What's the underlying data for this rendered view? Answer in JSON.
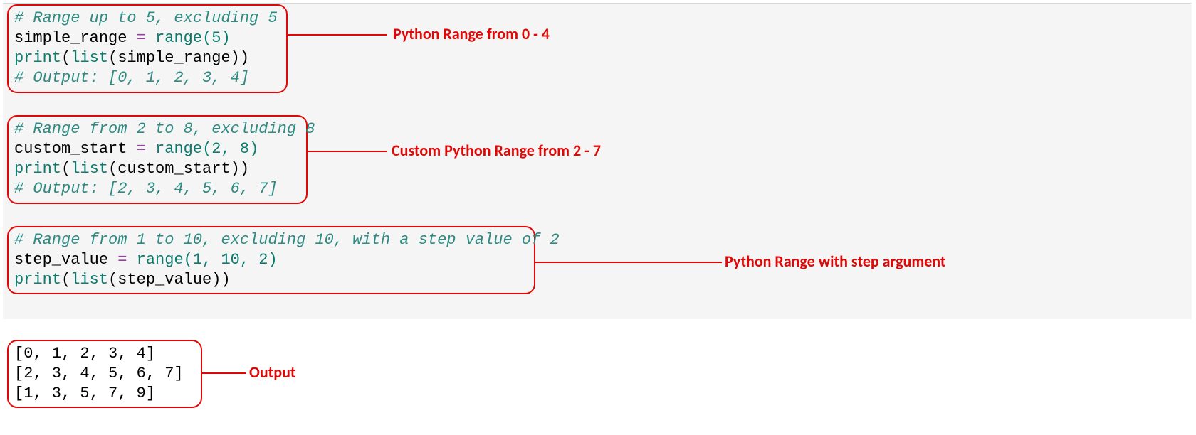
{
  "block1": {
    "comment1": "# Range up to 5, excluding 5",
    "l1_var": "simple_range",
    "l1_op": " = ",
    "l1_fn": "range",
    "l1_args": "(5)",
    "l2_fn": "print",
    "l2_open": "(",
    "l2_inner_fn": "list",
    "l2_inner_args": "(simple_range))",
    "comment2": "# Output: [0, 1, 2, 3, 4]",
    "label": "Python Range from 0 - 4"
  },
  "block2": {
    "comment1": "# Range from 2 to 8, excluding 8",
    "l1_var": "custom_start",
    "l1_op": " = ",
    "l1_fn": "range",
    "l1_args": "(2, 8)",
    "l2_fn": "print",
    "l2_open": "(",
    "l2_inner_fn": "list",
    "l2_inner_args": "(custom_start))",
    "comment2": "# Output: [2, 3, 4, 5, 6, 7]",
    "label": "Custom Python Range from 2 - 7"
  },
  "block3": {
    "comment1": "# Range from 1 to 10, excluding 10, with a step value of 2",
    "l1_var": "step_value",
    "l1_op": " = ",
    "l1_fn": "range",
    "l1_args": "(1, 10, 2)",
    "l2_fn": "print",
    "l2_open": "(",
    "l2_inner_fn": "list",
    "l2_inner_args": "(step_value))",
    "label": "Python Range with step argument"
  },
  "output": {
    "line1": "[0, 1, 2, 3, 4]",
    "line2": "[2, 3, 4, 5, 6, 7]",
    "line3": "[1, 3, 5, 7, 9]",
    "label": "Output"
  }
}
